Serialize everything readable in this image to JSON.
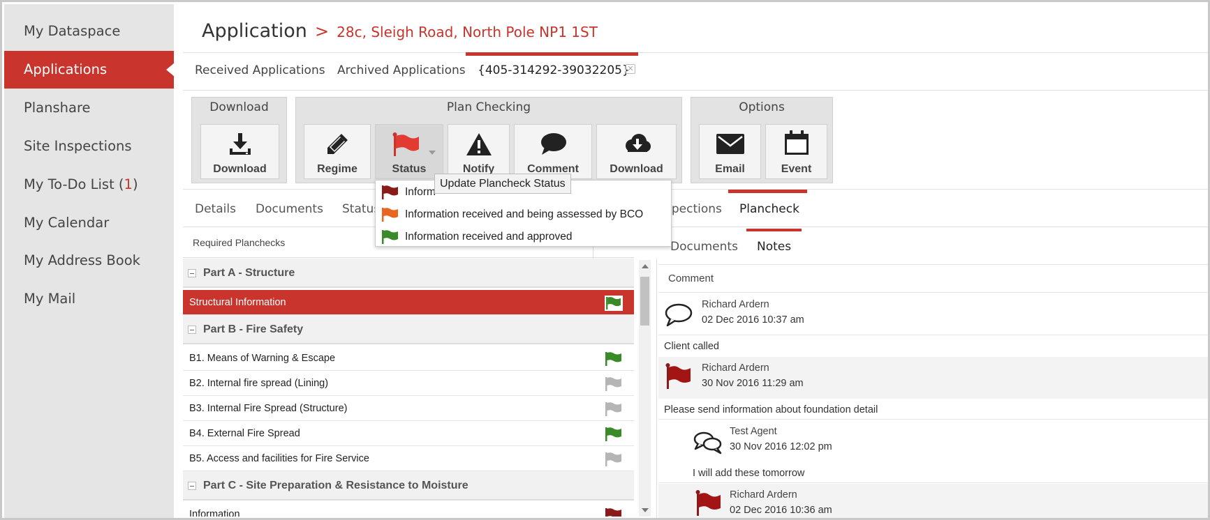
{
  "sidebar": {
    "items": [
      {
        "label": "My Dataspace"
      },
      {
        "label": "Applications"
      },
      {
        "label": "Planshare"
      },
      {
        "label": "Site Inspections"
      },
      {
        "label": "My To-Do List (",
        "count": "1",
        "suffix": ")"
      },
      {
        "label": "My Calendar"
      },
      {
        "label": "My Address Book"
      },
      {
        "label": "My Mail"
      }
    ]
  },
  "header": {
    "title": "Application",
    "separator": ">",
    "address": "28c, Sleigh Road, North Pole NP1 1ST"
  },
  "top_tabs": [
    "Received Applications",
    "Archived Applications",
    "{405-314292-39032205}"
  ],
  "toolbar": {
    "download_group": {
      "title": "Download",
      "buttons": [
        "Download"
      ]
    },
    "plan_group": {
      "title": "Plan Checking",
      "buttons": [
        "Regime",
        "Status",
        "Notify",
        "Comment",
        "Download"
      ]
    },
    "options_group": {
      "title": "Options",
      "buttons": [
        "Email",
        "Event"
      ]
    }
  },
  "sec_tabs": [
    "Details",
    "Documents",
    "Status",
    "spections",
    "Plancheck"
  ],
  "status_dropdown": {
    "tooltip": "Update Plancheck Status",
    "items": [
      {
        "label": "Inform",
        "flag": "dark-red-flag-icon",
        "color": "#8b1a1a"
      },
      {
        "label": "Information received and being assessed by BCO",
        "flag": "orange-flag-icon",
        "color": "#e8661f"
      },
      {
        "label": "Information received and approved",
        "flag": "green-flag-icon",
        "color": "#3a8a2a"
      }
    ]
  },
  "left_panel": {
    "header": "Required Planchecks",
    "sections": [
      {
        "title": "Part A - Structure"
      },
      {
        "title": "Part B - Fire Safety"
      },
      {
        "title": "Part C - Site Preparation & Resistance to Moisture"
      }
    ],
    "items": [
      {
        "label": "Structural Information",
        "flag": "green",
        "selected": true
      },
      {
        "label": "B1. Means of Warning & Escape",
        "flag": "green"
      },
      {
        "label": "B2. Internal fire spread (Lining)",
        "flag": "grey"
      },
      {
        "label": "B3. Internal Fire Spread (Structure)",
        "flag": "grey"
      },
      {
        "label": "B4. External Fire Spread",
        "flag": "green"
      },
      {
        "label": "B5. Access and facilities for Fire Service",
        "flag": "grey"
      },
      {
        "label": "Information",
        "flag": "red"
      }
    ]
  },
  "right_panel": {
    "tabs": [
      "Documents",
      "Notes"
    ],
    "column_header": "Comment",
    "notes": [
      {
        "author": "Richard Ardern",
        "date": "02 Dec 2016 10:37 am",
        "text": "Client called",
        "icon": "speech-bubble-icon"
      },
      {
        "author": "Richard Ardern",
        "date": "30 Nov 2016 11:29 am",
        "text": "Please send information about foundation detail",
        "icon": "red-flag-icon"
      },
      {
        "author": "Test Agent",
        "date": "30 Nov 2016 12:02 pm",
        "text": "I will add these tomorrow",
        "icon": "conversation-icon"
      },
      {
        "author": "Richard Ardern",
        "date": "02 Dec 2016 10:36 am",
        "text": "",
        "icon": "red-flag-icon"
      }
    ]
  },
  "colors": {
    "accent": "#c9342d",
    "flag_green": "#3a8a2a",
    "flag_grey": "#b5b5b5",
    "flag_red": "#8b1a1a",
    "sidebar_bg": "#e5e5e5"
  }
}
